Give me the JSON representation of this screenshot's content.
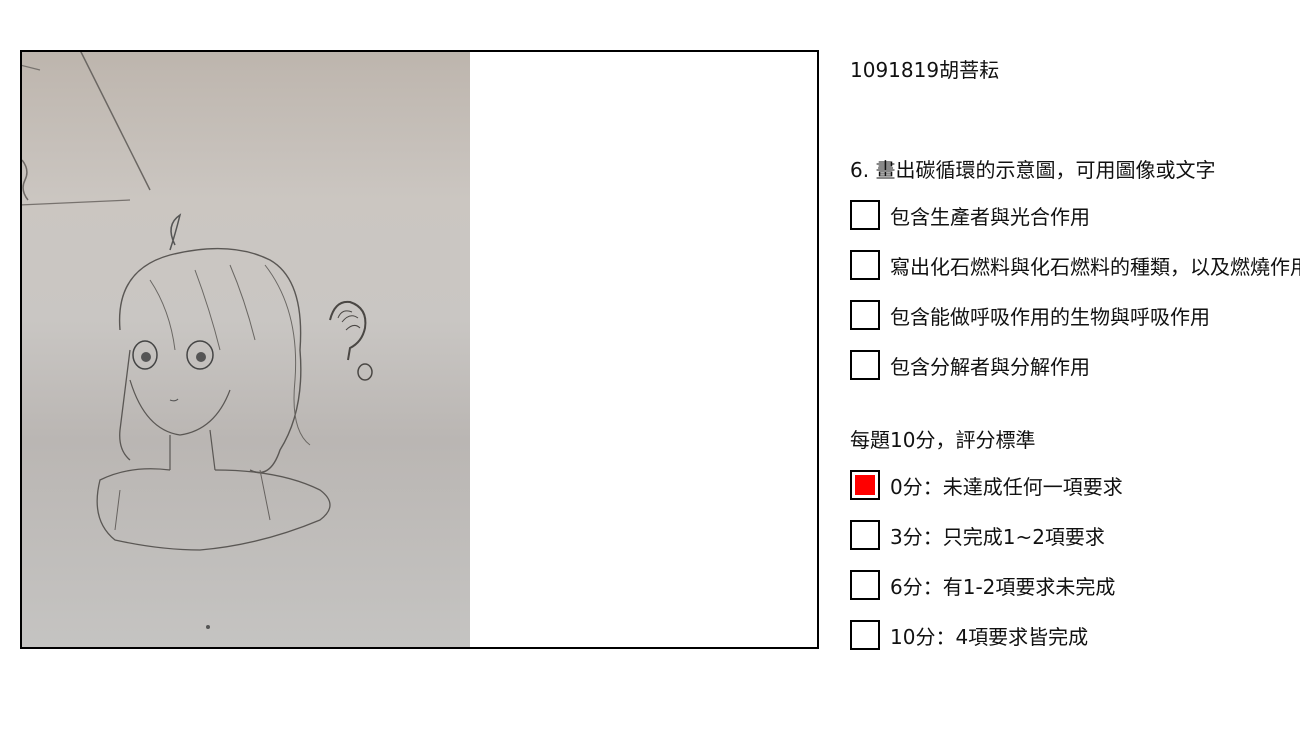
{
  "student": {
    "name": "1091819胡菩耘"
  },
  "question": {
    "title": "6. 畫出碳循環的示意圖，可用圖像或文字",
    "requirements": [
      {
        "label": "包含生產者與光合作用",
        "checked": false
      },
      {
        "label": "寫出化石燃料與化石燃料的種類，以及燃燒作用",
        "checked": false
      },
      {
        "label": "包含能做呼吸作用的生物與呼吸作用",
        "checked": false
      },
      {
        "label": "包含分解者與分解作用",
        "checked": false
      }
    ]
  },
  "rubric": {
    "title": "每題10分，評分標準",
    "options": [
      {
        "label": "0分：未達成任何一項要求",
        "checked": true
      },
      {
        "label": "3分：只完成1~2項要求",
        "checked": false
      },
      {
        "label": "6分：有1-2項要求未完成",
        "checked": false
      },
      {
        "label": "10分：4項要求皆完成",
        "checked": false
      }
    ]
  },
  "colors": {
    "check_fill": "#ff0000",
    "border": "#000000"
  }
}
